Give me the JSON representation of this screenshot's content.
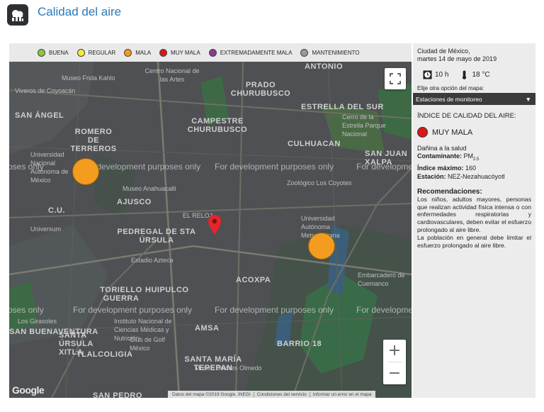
{
  "header": {
    "title": "Calidad del aire",
    "logo": "cloud-city-icon"
  },
  "legend": [
    {
      "label": "BUENA",
      "color": "#8cc63f"
    },
    {
      "label": "REGULAR",
      "color": "#f7e93b"
    },
    {
      "label": "MALA",
      "color": "#f39c1f"
    },
    {
      "label": "MUY MALA",
      "color": "#d7191c"
    },
    {
      "label": "EXTREMADAMENTE MALA",
      "color": "#8e3a8e"
    },
    {
      "label": "MANTENIMIENTO",
      "color": "#999999"
    }
  ],
  "map": {
    "labels": [
      "Museo Frida Kahlo",
      "Centro Nacional de las Artes",
      "PRADO CHURUBUSCO",
      "ANTONIO",
      "Viveros de Coyoacán",
      "SAN ÁNGEL",
      "ROMERO DE TERREROS",
      "CAMPESTRE CHURUBUSCO",
      "ESTRELLA DEL SUR",
      "Cerro de la Estrella Parque Nacional",
      "CULHUACAN",
      "SAN JUAN XALPA",
      "Universidad Nacional Autónoma de México",
      "Museo Anahuacalli",
      "Zoológico Los Coyotes",
      "AJUSCO",
      "C.U.",
      "Universum",
      "EL RELOJ",
      "PEDREGAL DE STA ÚRSULA",
      "Universidad Autónoma Metropolitana",
      "Estadio Azteca",
      "TORIELLO GUERRA",
      "HUIPULCO",
      "ACOXPA",
      "Embarcadero de Cuemanco",
      "Instituto Nacional de Ciencias Médicas y Nutrición",
      "Los Girasoles",
      "AMSA",
      "SAN BUENAVENTURA",
      "Club de Golf México",
      "SANTA ÚRSULA XITLA",
      "TLALCOLIGIA",
      "BARRIO 18",
      "Museo Dolores Olmedo",
      "SANTA MARÍA TEPEPAN",
      "SAN PEDRO"
    ],
    "watermark": "For development purposes only",
    "watermark_partial_left": "oses only",
    "watermark_partial_right": "For developme",
    "google_text": "Google",
    "attribution": [
      "Datos del mapa ©2019 Google, INEGI",
      "Condiciones del servicio",
      "Informar un error en el mapa"
    ],
    "zoom_in": "+",
    "zoom_out": "−"
  },
  "panel": {
    "city": "Ciudad de México,",
    "date": "martes 14 de mayo de 2019",
    "time": "10 h",
    "temperature": "18 °C",
    "map_option_label": "Elije otra opción del mapa:",
    "map_option_selected": "Estaciones de monitoreo",
    "iaq_title": "ÍNDICE DE CALIDAD DEL AIRE:",
    "status": "MUY MALA",
    "status_color": "#d7191c",
    "health": "Dañina a la salud",
    "pollutant_label": "Contaminante:",
    "pollutant_value": "PM",
    "pollutant_sub": "2.5",
    "max_index_label": "Índice máximo:",
    "max_index_value": "160",
    "station_label": "Estación:",
    "station_value": "NEZ-Nezahuacóyotl",
    "recommendations_title": "Recomendaciones:",
    "recommendations_1": "Los niños, adultos mayores, personas que realizan actividad física intensa o con enfermedades respiratorias y cardiovasculares, deben evitar el esfuerzo prolongado al aire libre.",
    "recommendations_2": "La población en general debe limitar el esfuerzo prolongado al aire libre."
  }
}
